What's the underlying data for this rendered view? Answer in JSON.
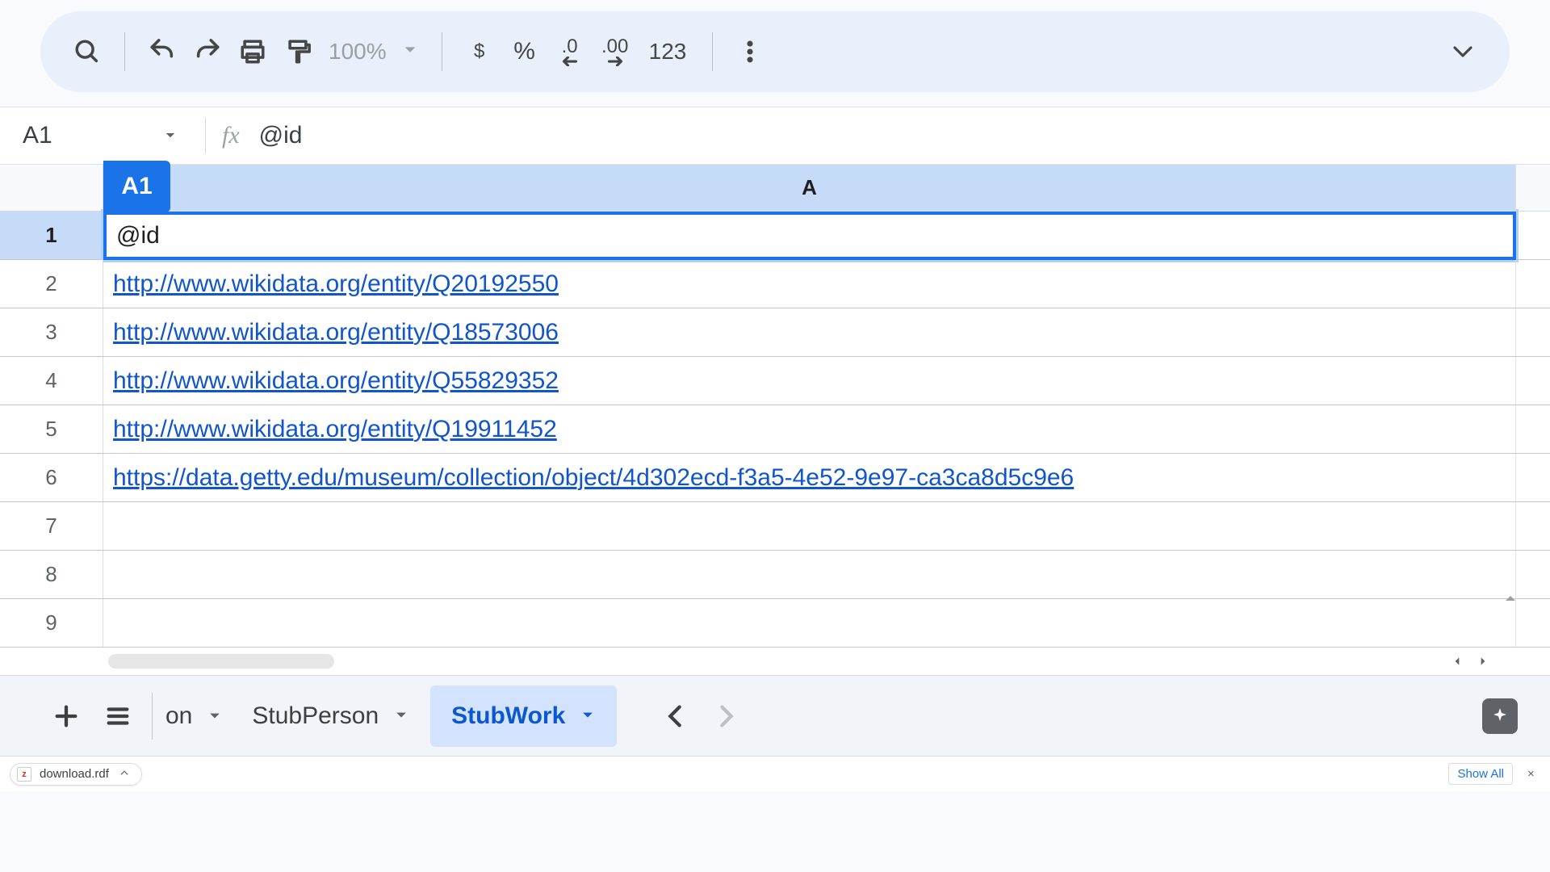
{
  "toolbar": {
    "zoom": "100%",
    "currency": "$",
    "percent": "%",
    "dec_decrease": ".0",
    "dec_increase": ".00",
    "numfmt": "123"
  },
  "namebox": "A1",
  "fx_label": "fx",
  "formula": "@id",
  "active_cell_badge": "A1",
  "col_header": "A",
  "rows": [
    {
      "n": "1",
      "value": "@id",
      "link": false,
      "selected": true
    },
    {
      "n": "2",
      "value": "http://www.wikidata.org/entity/Q20192550",
      "link": true,
      "selected": false
    },
    {
      "n": "3",
      "value": "http://www.wikidata.org/entity/Q18573006",
      "link": true,
      "selected": false
    },
    {
      "n": "4",
      "value": "http://www.wikidata.org/entity/Q55829352",
      "link": true,
      "selected": false
    },
    {
      "n": "5",
      "value": "http://www.wikidata.org/entity/Q19911452",
      "link": true,
      "selected": false
    },
    {
      "n": "6",
      "value": "https://data.getty.edu/museum/collection/object/4d302ecd-f3a5-4e52-9e97-ca3ca8d5c9e6",
      "link": true,
      "selected": false
    },
    {
      "n": "7",
      "value": "",
      "link": false,
      "selected": false
    },
    {
      "n": "8",
      "value": "",
      "link": false,
      "selected": false
    },
    {
      "n": "9",
      "value": "",
      "link": false,
      "selected": false
    }
  ],
  "sheets": {
    "partial": "on",
    "tabs": [
      {
        "label": "StubPerson",
        "active": false
      },
      {
        "label": "StubWork",
        "active": true
      }
    ]
  },
  "download": {
    "filename": "download.rdf",
    "show_all": "Show All",
    "close": "×"
  }
}
